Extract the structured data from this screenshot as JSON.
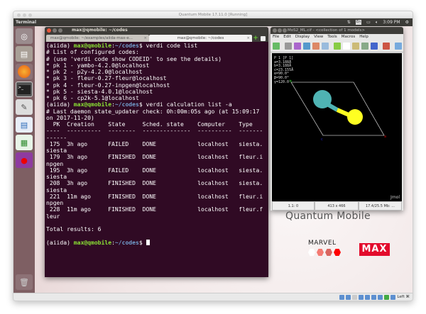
{
  "vbox": {
    "title": "Quantum Mobile 17.11.0 [Running]",
    "host_key": "Left ⌘"
  },
  "panel": {
    "app": "Terminal",
    "time": "3:09 PM",
    "keyboard": "En"
  },
  "launcher": [
    "ubuntu-dash-icon",
    "files-icon",
    "firefox-icon",
    "terminal-icon",
    "text-editor-icon",
    "writer-icon",
    "calc-icon",
    "jmol-icon",
    "trash-icon"
  ],
  "terminal": {
    "title": "max@qmobile: ~/codes",
    "tabs": [
      {
        "label": "max@qmobile: ~/examples/aiida-max-e..."
      },
      {
        "label": "max@qmobile: ~/codes"
      }
    ],
    "prompt": {
      "env": "(aiida) ",
      "user": "max@qmobile",
      "sep": ":",
      "path": "~/codes",
      "dollar": "$ "
    },
    "lines": [
      {
        "cmd": "verdi code list"
      },
      {
        "text": "# List of configured codes:"
      },
      {
        "text": "# (use 'verdi code show CODEID' to see the details)"
      },
      {
        "text": "* pk 1 - yambo-4.2.0@localhost"
      },
      {
        "text": "* pk 2 - p2y-4.2.0@localhost"
      },
      {
        "text": "* pk 3 - fleur-0.27-fleur@localhost"
      },
      {
        "text": "* pk 4 - fleur-0.27-inpgen@localhost"
      },
      {
        "text": "* pk 5 - siesta-4.0.1@localhost"
      },
      {
        "text": "* pk 6 - cp2k-5.1@localhost"
      },
      {
        "cmd": "verdi calculation list -a"
      },
      {
        "text": "# Last daemon state_updater check: 0h:00m:05s ago (at 15:09:17"
      },
      {
        "text": "on 2017-11-20)"
      },
      {
        "text": "  PK  Creation    State     Sched. state    Computer    Type"
      },
      {
        "text": "----  ----------  --------  --------------  ----------  -------"
      },
      {
        "text": "------"
      },
      {
        "text": " 175  3h ago      FAILED    DONE            localhost   siesta."
      },
      {
        "text": "siesta"
      },
      {
        "text": " 179  3h ago      FINISHED  DONE            localhost   fleur.i"
      },
      {
        "text": "npgen"
      },
      {
        "text": " 195  3h ago      FAILED    DONE            localhost   siesta."
      },
      {
        "text": "siesta"
      },
      {
        "text": " 208  3h ago      FINISHED  DONE            localhost   siesta."
      },
      {
        "text": "siesta"
      },
      {
        "text": " 221  11m ago     FINISHED  DONE            localhost   fleur.i"
      },
      {
        "text": "npgen"
      },
      {
        "text": " 228  11m ago     FINISHED  DONE            localhost   fleur.f"
      },
      {
        "text": "leur"
      },
      {
        "text": ""
      },
      {
        "text": "Total results: 6"
      },
      {
        "text": ""
      },
      {
        "cmd": "",
        "cursor": true
      }
    ]
  },
  "jmol": {
    "title": "MoS2_ML.cif - <collection of 1 models>",
    "menu": [
      "File",
      "Edit",
      "Display",
      "View",
      "Tools",
      "Macros",
      "Help"
    ],
    "unitcell": [
      "P 1 [P 1]",
      "a=3.188Å",
      "b=3.188Å",
      "c=23.155Å",
      "α=90.0°",
      "β=90.0°",
      "γ=120.0°"
    ],
    "axes": {
      "a": "a",
      "b": "b",
      "c": "c"
    },
    "logo": "Jmol",
    "status": [
      "1.1: 0",
      "413 x 466",
      "17.4/25.5 Mb:   ..."
    ],
    "colors": {
      "mo": "#4fb3b3",
      "s": "#ffff22"
    }
  },
  "branding": {
    "title": "Quantum Mobile",
    "marvel": "MARVEL",
    "max": "MAX",
    "max_color": "#e30b2c"
  }
}
